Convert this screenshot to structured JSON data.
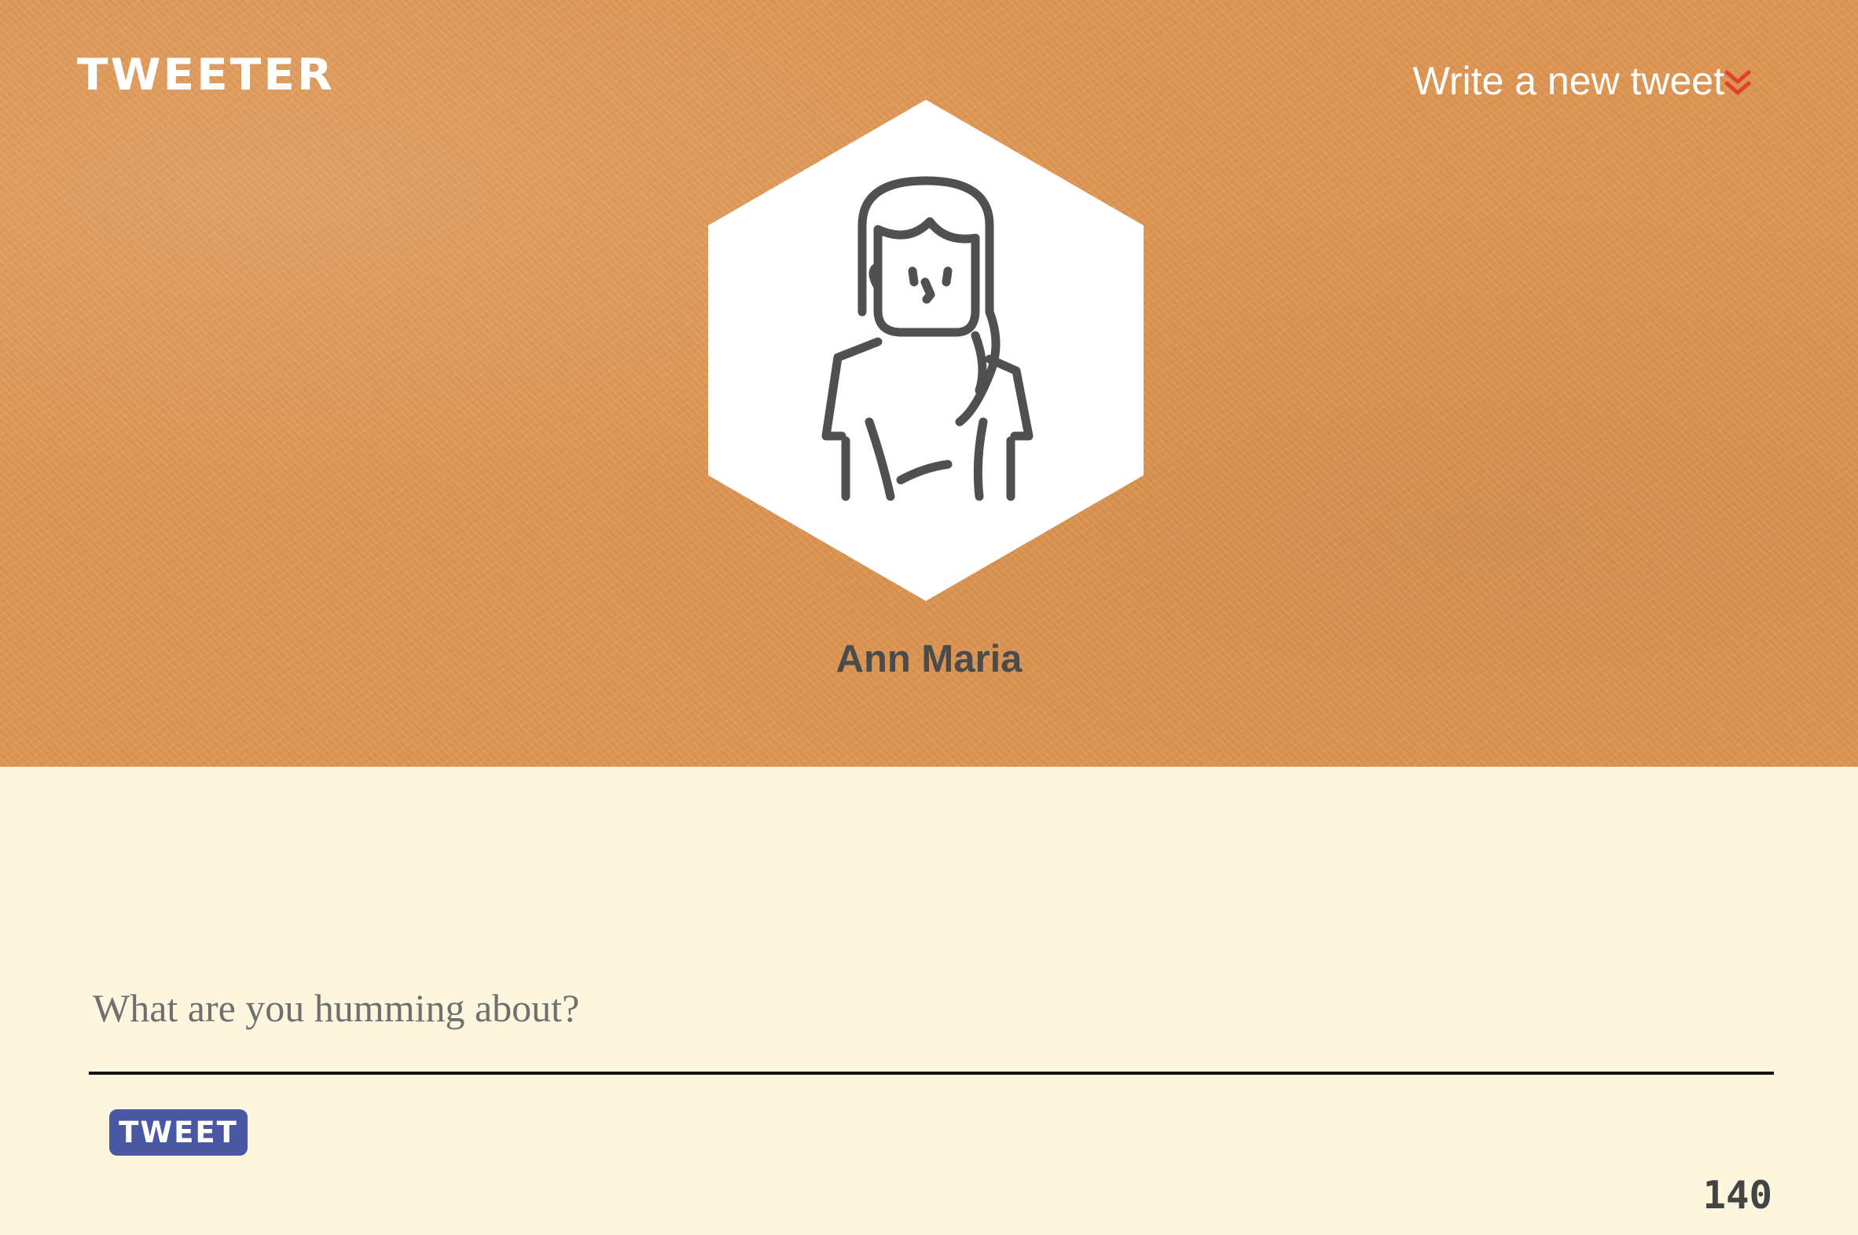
{
  "header": {
    "brand": "TWEETER",
    "new_tweet_label": "Write a new tweet",
    "new_tweet_icon": "double-chevron-down-icon",
    "background_color": "#df9652",
    "accent_color": "#e2402a"
  },
  "profile": {
    "name": "Ann Maria",
    "avatar_icon": "woman-avatar-icon"
  },
  "composer": {
    "placeholder": "What are you humming about?",
    "value": "",
    "tweet_button_label": "TWEET",
    "tweet_button_color": "#4a57a2",
    "char_counter": "140"
  }
}
